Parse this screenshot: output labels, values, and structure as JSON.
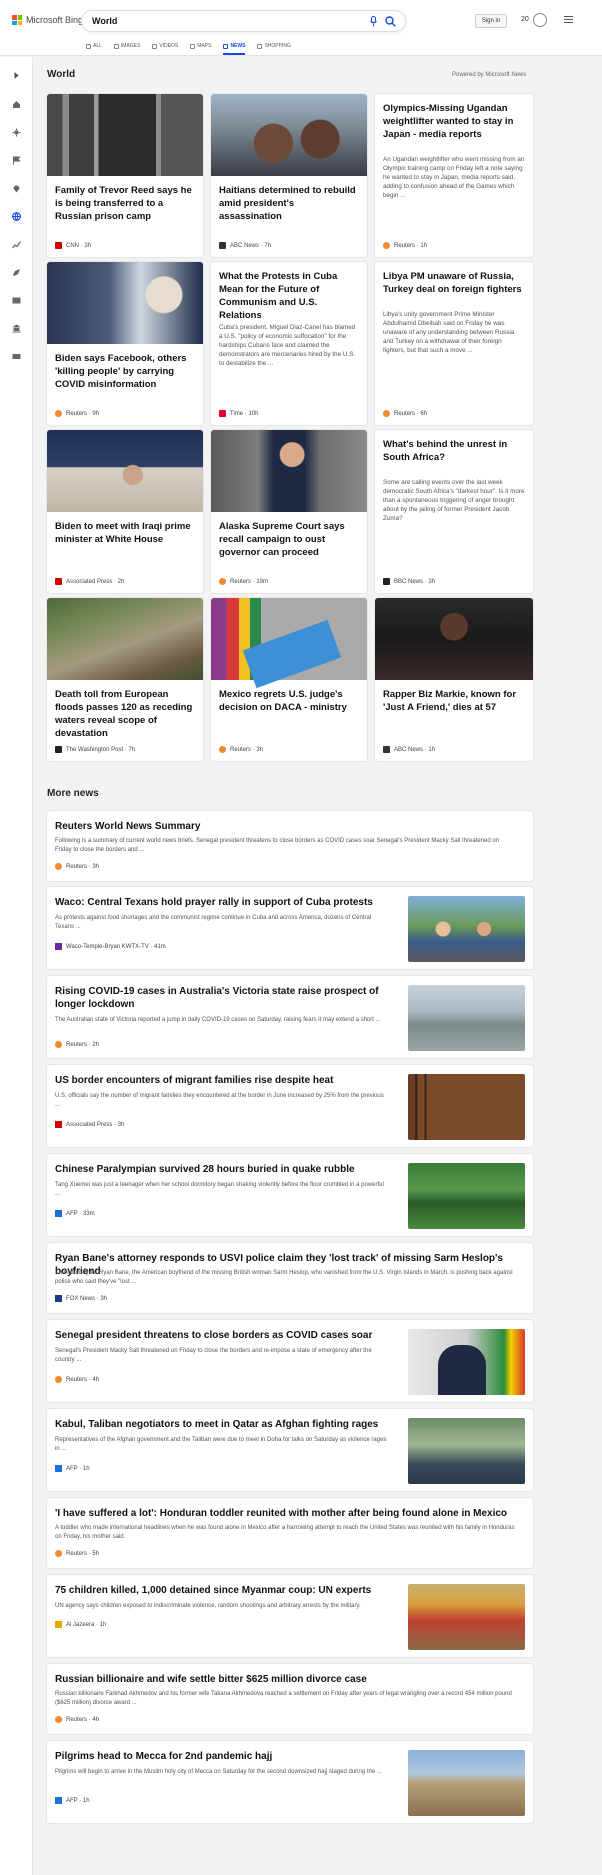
{
  "brand": {
    "name": "Microsoft Bing"
  },
  "search": {
    "value": "World"
  },
  "header": {
    "signin": "Sign in",
    "points": "20"
  },
  "tabs": [
    {
      "label": "ALL"
    },
    {
      "label": "IMAGES"
    },
    {
      "label": "VIDEOS"
    },
    {
      "label": "MAPS"
    },
    {
      "label": "NEWS",
      "active": true
    },
    {
      "label": "SHOPPING"
    }
  ],
  "world": {
    "title": "World",
    "powered": "Powered by Microsoft News",
    "cards": [
      {
        "title": "Family of Trevor Reed says he is being transferred to a Russian prison camp",
        "source": "CNN · 3h",
        "src_color": "#cc0000"
      },
      {
        "title": "Haitians determined to rebuild amid president's assassination",
        "source": "ABC News · 7h",
        "src_color": "#333333"
      },
      {
        "title": "Olympics-Missing Ugandan weightlifter wanted to stay in Japan - media reports",
        "snippet": "An Ugandan weightlifter who went missing from an Olympic training camp on Friday left a note saying he wanted to stay in Japan, media reports said, adding to confusion ahead of the Games which begin ...",
        "source": "Reuters · 1h",
        "src_color": "#f28a2e"
      },
      {
        "title": "Biden says Facebook, others 'killing people' by carrying COVID misinformation",
        "source": "Reuters · 9h",
        "src_color": "#f28a2e"
      },
      {
        "title": "What the Protests in Cuba Mean for the Future of Communism and U.S. Relations",
        "snippet": "Cuba's president, Miguel Diaz-Canel has blamed a U.S. \"policy of economic suffocation\" for the hardships Cubans face and claimed the demonstrators are mercenaries hired by the U.S. to destabilize the ...",
        "source": "Time · 10h",
        "src_color": "#e4002b"
      },
      {
        "title": "Libya PM unaware of Russia, Turkey deal on foreign fighters",
        "snippet": "Libya's unity government Prime Minister Abdulhamid Dbeibah said on Friday he was unaware of any understanding between Russia and Turkey on a withdrawal of their foreign fighters, but that such a move ...",
        "source": "Reuters · 6h",
        "src_color": "#f28a2e"
      },
      {
        "title": "Biden to meet with Iraqi prime minister at White House",
        "source": "Associated Press · 2h",
        "src_color": "#d40000"
      },
      {
        "title": "Alaska Supreme Court says recall campaign to oust governor can proceed",
        "source": "Reuters · 19m",
        "src_color": "#f28a2e"
      },
      {
        "title": "What's behind the unrest in South Africa?",
        "snippet": "Some are calling events over the last week democratic South Africa's \"darkest hour\". Is it more than a spontaneous triggering of anger brought about by the jailing of former President Jacob Zuma?",
        "source": "BBC News · 3h",
        "src_color": "#222222"
      },
      {
        "title": "Death toll from European floods passes 120 as receding waters reveal scope of devastation",
        "source": "The Washington Post · 7h",
        "src_color": "#222222"
      },
      {
        "title": "Mexico regrets U.S. judge's decision on DACA - ministry",
        "source": "Reuters · 3h",
        "src_color": "#f28a2e"
      },
      {
        "title": "Rapper Biz Markie, known for 'Just A Friend,' dies at 57",
        "source": "ABC News · 1h",
        "src_color": "#333333"
      }
    ]
  },
  "more": {
    "title": "More news",
    "items": [
      {
        "title": "Reuters World News Summary",
        "snippet": "Following is a summary of current world news briefs. Senegal president threatens to close borders as COVID cases soar Senegal's President Macky Sall threatened on Friday to close the borders and ...",
        "source": "Reuters · 3h",
        "src_color": "#f28a2e"
      },
      {
        "title": "Waco: Central Texans hold prayer rally in support of Cuba protests",
        "snippet": "As protests against food shortages and the communist regime continue in Cuba and across America, dozens of Central Texans ...",
        "source": "Waco-Temple-Bryan KWTX-TV · 41m",
        "src_color": "#6a2ca0"
      },
      {
        "title": "Rising COVID-19 cases in Australia's Victoria state raise prospect of longer lockdown",
        "snippet": "The Australian state of Victoria reported a jump in daily COVID-19 cases on Saturday, raising fears it may extend a short ...",
        "source": "Reuters · 2h",
        "src_color": "#f28a2e"
      },
      {
        "title": "US border encounters of migrant families rise despite heat",
        "snippet": "U.S. officials say the number of migrant families they encountered at the border in June increased by 25% from the previous ...",
        "source": "Associated Press · 3h",
        "src_color": "#d40000"
      },
      {
        "title": "Chinese Paralympian survived 28 hours buried in quake rubble",
        "snippet": "Tang Xuemei was just a teenager when her school dormitory began shaking violently before the floor crumbled in a powerful ...",
        "source": "AFP · 33m",
        "src_color": "#1e6fd9"
      },
      {
        "title": "Ryan Bane's attorney responds to USVI police claim they 'lost track' of missing Sarm Heslop's boyfriend",
        "snippet": "The attorney for Ryan Bane, the American boyfriend of the missing British woman Sarm Heslop, who vanished from the U.S. Virgin Islands in March, is pushing back against police who said they've \"lost ...",
        "source": "FOX News · 3h",
        "src_color": "#1a3a8a"
      },
      {
        "title": "Senegal president threatens to close borders as COVID cases soar",
        "snippet": "Senegal's President Macky Sall threatened on Friday to close the borders and re-impose a state of emergency after the country ...",
        "source": "Reuters · 4h",
        "src_color": "#f28a2e"
      },
      {
        "title": "Kabul, Taliban negotiators to meet in Qatar as Afghan fighting rages",
        "snippet": "Representatives of the Afghan government and the Taliban were due to meet in Doha for talks on Saturday as violence rages in ...",
        "source": "AFP · 1h",
        "src_color": "#1e6fd9"
      },
      {
        "title": "'I have suffered a lot': Honduran toddler reunited with mother after being found alone in Mexico",
        "snippet": "A toddler who made international headlines when he was found alone in Mexico after a harrowing attempt to reach the United States was reunited with his family in Honduras on Friday, his mother said.",
        "source": "Reuters · 5h",
        "src_color": "#f28a2e"
      },
      {
        "title": "75 children killed, 1,000 detained since Myanmar coup: UN experts",
        "snippet": "UN agency says children exposed to indiscriminate violence, random shootings and arbitrary arrests by the military.",
        "source": "Al Jazeera · 1h",
        "src_color": "#e0a800"
      },
      {
        "title": "Russian billionaire and wife settle bitter $625 million divorce case",
        "snippet": "Russian billionaire Farkhad Akhmedov and his former wife Tatiana Akhmedova reached a settlement on Friday after years of legal wrangling over a record 454 million pound ($625 million) divorce award ...",
        "source": "Reuters · 4h",
        "src_color": "#f28a2e"
      },
      {
        "title": "Pilgrims head to Mecca for 2nd pandemic hajj",
        "snippet": "Pilgrims will begin to arrive in the Muslim holy city of Mecca on Saturday for the second downsized hajj staged during the ...",
        "source": "AFP · 1h",
        "src_color": "#1e6fd9"
      }
    ]
  }
}
